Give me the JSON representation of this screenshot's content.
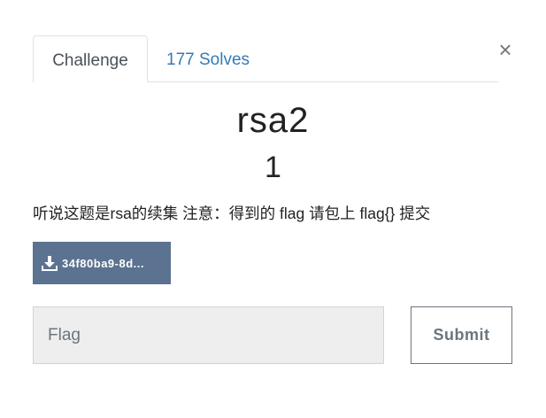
{
  "tabs": {
    "challenge_label": "Challenge",
    "solves_label": "177 Solves"
  },
  "close_icon": "close-icon",
  "challenge": {
    "name": "rsa2",
    "value": "1",
    "description": "听说这题是rsa的续集 注意：得到的 flag 请包上 flag{} 提交",
    "file_label": "34f80ba9-8d...",
    "file_icon": "download-icon"
  },
  "submission": {
    "placeholder": "Flag",
    "value": "",
    "submit_label": "Submit"
  },
  "colors": {
    "link": "#337ab7",
    "file_button": "#5b7290",
    "input_bg": "#eeeeee"
  }
}
